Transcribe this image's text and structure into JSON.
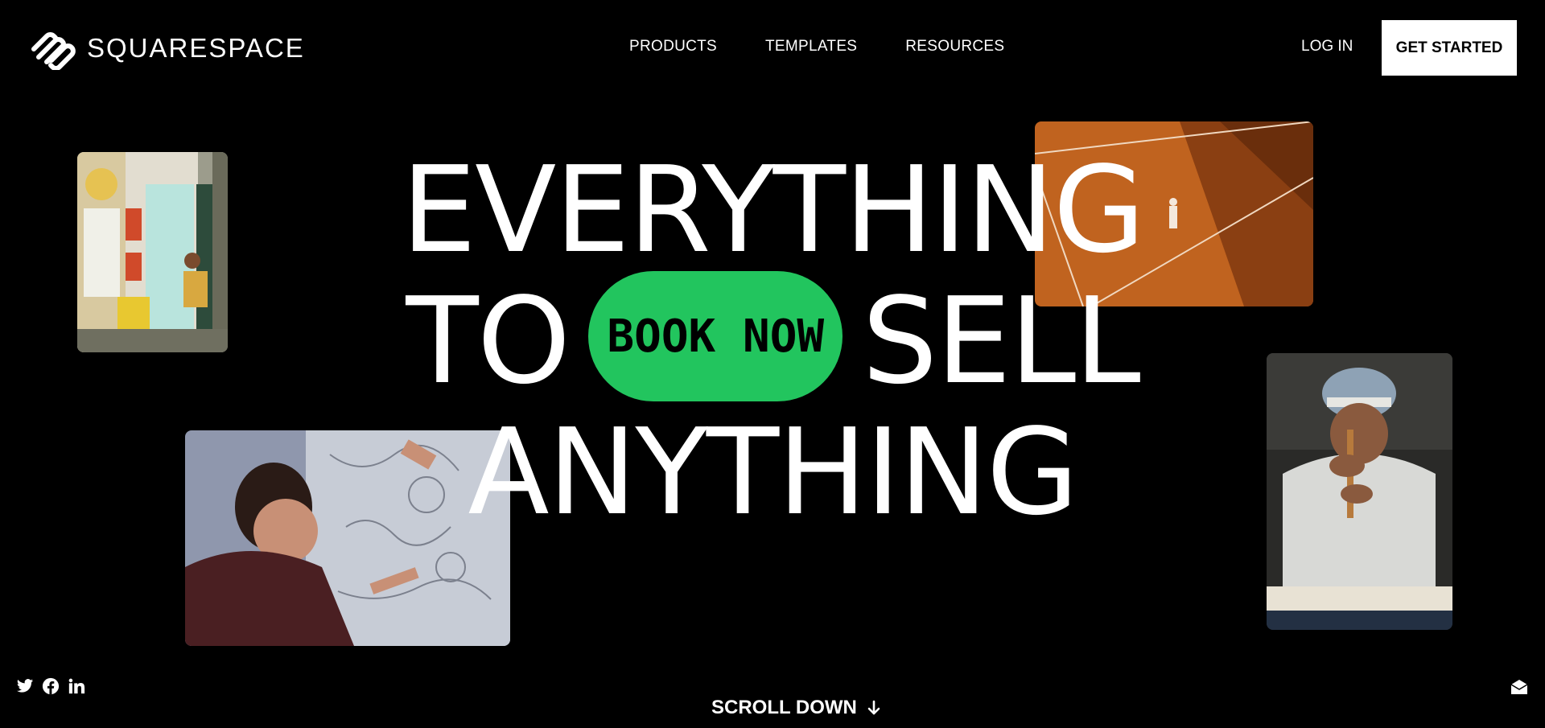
{
  "header": {
    "brand": "SQUARESPACE",
    "nav": [
      "PRODUCTS",
      "TEMPLATES",
      "RESOURCES"
    ],
    "login_label": "LOG IN",
    "cta_label": "GET STARTED"
  },
  "hero": {
    "line1": "EVERYTHING",
    "line2_left": "TO",
    "pill_label": "BOOK NOW",
    "line2_right": "SELL",
    "line3": "ANYTHING"
  },
  "footer": {
    "scroll_label": "SCROLL DOWN",
    "social_icons": [
      "twitter-icon",
      "facebook-icon",
      "linkedin-icon"
    ]
  },
  "colors": {
    "background": "#000000",
    "accent_pill": "#22c55e",
    "cta_bg": "#ffffff"
  }
}
